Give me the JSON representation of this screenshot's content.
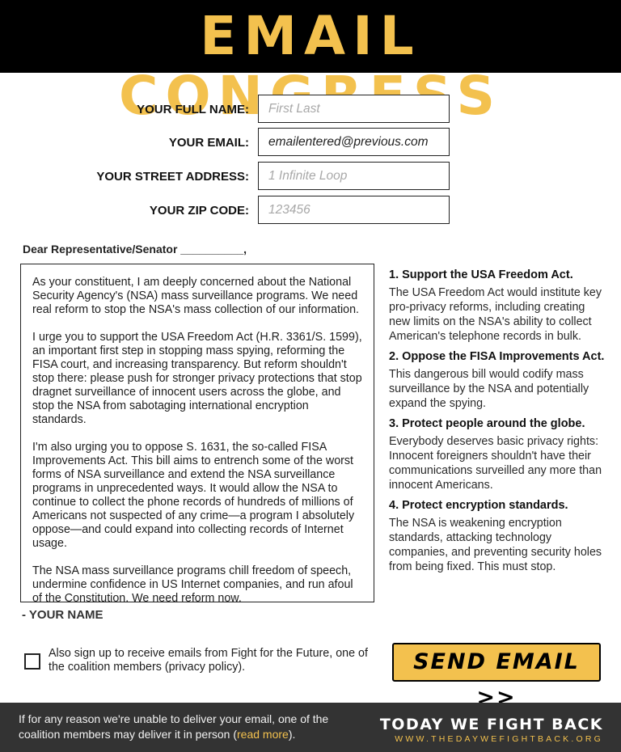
{
  "header": {
    "title": "EMAIL CONGRESS"
  },
  "form": {
    "name_label": "YOUR FULL NAME:",
    "name_placeholder": "First Last",
    "email_label": "YOUR EMAIL:",
    "email_value": "emailentered@previous.com",
    "address_label": "YOUR STREET ADDRESS:",
    "address_placeholder": "1 Infinite Loop",
    "zip_label": "YOUR ZIP CODE:",
    "zip_placeholder": "123456"
  },
  "letter": {
    "salutation": "Dear Representative/Senator __________,",
    "paragraphs": [
      "As your constituent, I am deeply concerned about the National Security Agency's (NSA) mass surveillance programs. We need real reform to stop the NSA's mass collection of our information.",
      "I urge you to support the USA Freedom Act (H.R. 3361/S. 1599), an important first step in stopping mass spying, reforming the FISA court, and increasing transparency. But reform shouldn't stop there: please push for stronger privacy protections that stop dragnet surveillance of innocent users across the globe, and stop the NSA from sabotaging international encryption standards.",
      "I'm also urging you to oppose S. 1631, the so-called FISA Improvements Act. This bill aims to entrench some of the worst forms of NSA surveillance and extend the NSA surveillance programs in unprecedented ways. It would allow the NSA to continue to collect the phone records of hundreds of millions of Americans not suspected of any crime—a program I absolutely oppose—and could expand into collecting records of Internet usage.",
      "The NSA mass surveillance programs chill freedom of speech, undermine confidence in US Internet companies, and run afoul of the Constitution.  We need reform now."
    ],
    "signature": "- YOUR NAME"
  },
  "points": [
    {
      "title": "1. Support the USA Freedom Act.",
      "body": "The USA Freedom Act would institute key pro-privacy reforms, including creating new limits on the NSA's ability to collect American's telephone records in bulk."
    },
    {
      "title": "2. Oppose the FISA Improvements Act.",
      "body": "This dangerous bill would codify mass surveillance by the NSA and potentially expand the spying."
    },
    {
      "title": "3. Protect people around the globe.",
      "body": "Everybody deserves basic privacy rights: Innocent foreigners shouldn't have their communications surveilled any more than innocent Americans."
    },
    {
      "title": "4. Protect encryption standards.",
      "body": "The NSA is weakening encryption standards, attacking technology companies, and preventing security holes from being fixed. This must stop."
    }
  ],
  "optin": {
    "text": "Also sign up to receive emails from Fight for the Future, one of the coalition members (privacy policy).",
    "checked": false
  },
  "send_button": {
    "label": "SEND EMAIL >>"
  },
  "footer": {
    "text_before": "If for any reason we're unable to deliver your email, one of the coalition members may deliver it in person (",
    "link_text": "read more",
    "text_after": ").",
    "brand_title": "TODAY WE FIGHT BACK",
    "brand_url": "WWW.THEDAYWEFIGHTBACK.ORG"
  },
  "colors": {
    "accent": "#f3c14e",
    "header_bg": "#000000",
    "footer_bg": "#333333"
  }
}
